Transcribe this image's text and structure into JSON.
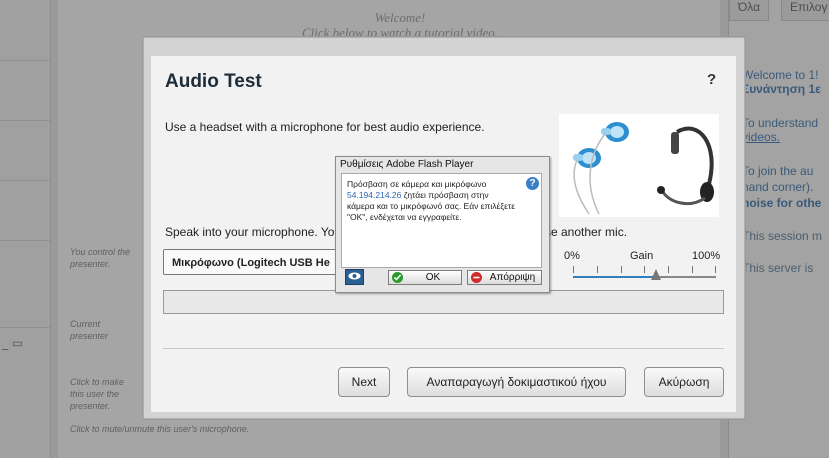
{
  "background": {
    "welcome_title": "Welcome!",
    "welcome_sub": "Click below to watch a tutorial video.",
    "notes": [
      "You control the presenter.",
      "Current presenter",
      "Click to make this user the presenter.",
      "Click to mute/unmute this user's microphone."
    ],
    "tabs": [
      "Όλα",
      "Επιλογ"
    ],
    "right_texts": [
      "Welcome to 1!",
      "Συνάντηση 1ε",
      "To understand",
      "videos.",
      "To join the au",
      "hand corner).",
      "noise for othe",
      "This session m",
      "This server is"
    ]
  },
  "dialog": {
    "title": "Audio Test",
    "help": "?",
    "instructions": "Use a headset with a microphone for best audio experience.",
    "speak_prefix": "Speak into your microphone. Yo",
    "speak_suffix": "se another mic.",
    "mic_selected": "Μικρόφωνο (Logitech USB He",
    "gain": {
      "min": "0%",
      "label": "Gain",
      "max": "100%",
      "level": 0.58
    },
    "buttons": {
      "next": "Next",
      "play": "Αναπαραγωγή δοκιμαστικού ήχου",
      "cancel": "Ακύρωση"
    }
  },
  "flash": {
    "title": "Ρυθμίσεις Adobe Flash Player",
    "line1": "Πρόσβαση σε κάμερα και μικρόφωνο",
    "ip": "54.194.214.26",
    "line2": " ζητάει πρόσβαση στην κάμερα και το μικρόφωνό σας. Εάν επιλέξετε \"OK\", ενδέχεται να εγγραφείτε.",
    "help": "?",
    "ok": "OK",
    "deny": "Απόρριψη"
  },
  "colors": {
    "accent": "#2f7fbf",
    "ok_icon": "#2a9a2a",
    "deny_icon": "#d12a2a"
  }
}
